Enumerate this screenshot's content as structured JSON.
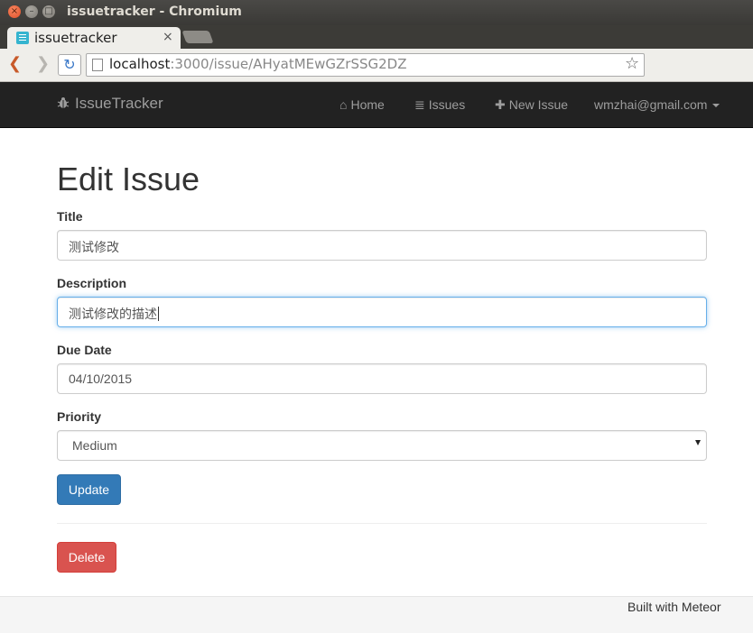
{
  "window": {
    "title": "issuetracker - Chromium",
    "close_glyph": "×",
    "min_glyph": "–",
    "max_glyph": "□"
  },
  "browser": {
    "tab_title": "issuetracker",
    "tab_close": "×",
    "url_host": "localhost",
    "url_rest": ":3000/issue/AHyatMEwGZrSSG2DZ",
    "back_glyph": "❮",
    "forward_glyph": "❯",
    "reload_glyph": "↻",
    "star_glyph": "☆"
  },
  "navbar": {
    "brand": "IssueTracker",
    "links": [
      {
        "label": "Home",
        "icon": "home-icon",
        "glyph": "⌂"
      },
      {
        "label": "Issues",
        "icon": "list-icon",
        "glyph": "≣"
      },
      {
        "label": "New Issue",
        "icon": "plus-icon",
        "glyph": "✚"
      }
    ],
    "user": "wmzhai@gmail.com"
  },
  "page": {
    "heading": "Edit Issue",
    "form": {
      "title_label": "Title",
      "title_value": "测试修改",
      "description_label": "Description",
      "description_value": "测试修改的描述",
      "due_label": "Due Date",
      "due_value": "04/10/2015",
      "priority_label": "Priority",
      "priority_value": "Medium"
    },
    "update_label": "Update",
    "delete_label": "Delete"
  },
  "footer": {
    "text": "Built with Meteor"
  },
  "colors": {
    "primary": "#337ab7",
    "danger": "#d9534f",
    "navbar": "#222222",
    "focus": "#66afe9"
  }
}
